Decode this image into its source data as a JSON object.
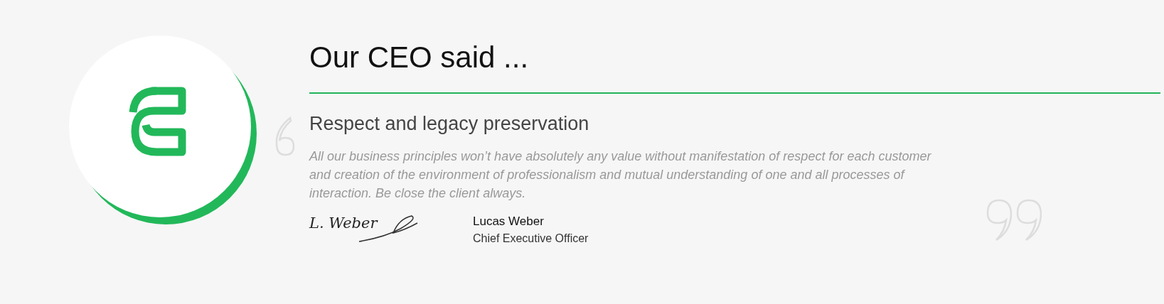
{
  "title": "Our CEO said ...",
  "quote": {
    "heading": "Respect and legacy preservation",
    "text": "All our business principles won’t have absolutely any value without manifestation of respect for each customer and creation of the environment of professionalism and mutual understanding of one and all processes of interaction. Be close the client always."
  },
  "author": {
    "signature": "L. Weber",
    "name": "Lucas Weber",
    "role": "Chief Executive Officer"
  }
}
